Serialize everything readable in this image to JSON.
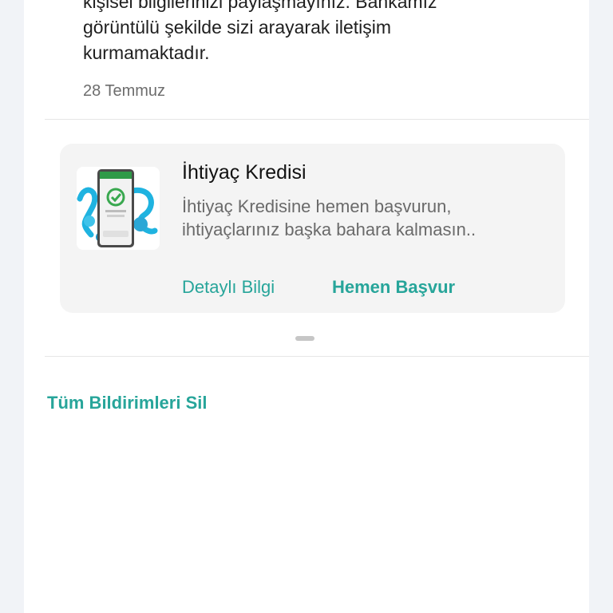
{
  "notification": {
    "text_lines": [
      "kişisel bilgilerinizi paylaşmayınız. Bankamız",
      "görüntülü şekilde sizi arayarak iletişim",
      "kurmamaktadır."
    ],
    "date": "28 Temmuz"
  },
  "campaign_card": {
    "image_icon": "loan-app-illustration",
    "title": "İhtiyaç Kredisi",
    "description_lines": [
      "İhtiyaç Kredisine hemen başvurun,",
      "ihtiyaçlarınız başka bahara kalmasın.."
    ],
    "detail_link": "Detaylı Bilgi",
    "apply_link": "Hemen Başvur"
  },
  "actions": {
    "delete_all": "Tüm Bildirimleri Sil"
  },
  "colors": {
    "accent": "#27a59a",
    "background": "#f1f3f7",
    "card_background": "#f4f4f4"
  }
}
